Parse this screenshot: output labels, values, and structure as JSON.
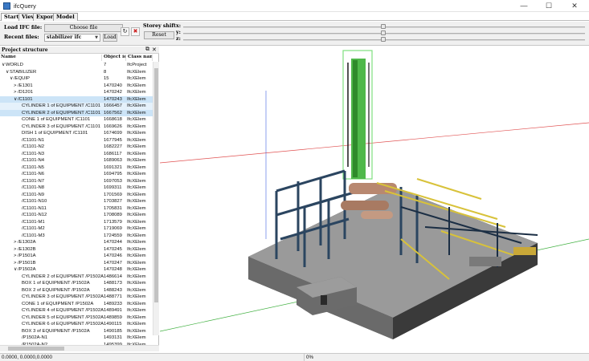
{
  "window": {
    "title": "ifcQuery",
    "min_icon": "minimize-icon",
    "max_icon": "maximize-icon",
    "close_icon": "close-icon"
  },
  "menu": {
    "tabs": [
      "Start",
      "View",
      "Export",
      "Model"
    ],
    "active": "Start"
  },
  "ribbon": {
    "load_ifc_label": "Load IFC file:",
    "choose_file": "Choose file",
    "recent_label": "Recent files:",
    "recent_value": "stabilizer ifc",
    "load_button": "Load",
    "storey_label": "Storey shift",
    "axis_x": "x:",
    "axis_y": "y:",
    "axis_z": "z:",
    "reset": "Reset",
    "icons": [
      "refresh-icon",
      "delete-icon"
    ]
  },
  "panel": {
    "title": "Project structure",
    "columns": [
      "Name",
      "Object id",
      "Class name"
    ],
    "rows": [
      {
        "name": "WORLD",
        "id": "7",
        "cls": "IfcProject",
        "indent": 0,
        "exp": "∨"
      },
      {
        "name": "STABILIZER",
        "id": "8",
        "cls": "IfcXElem",
        "indent": 1,
        "exp": "∨"
      },
      {
        "name": "/EQUIP",
        "id": "15",
        "cls": "IfcXElem",
        "indent": 2,
        "exp": "∨"
      },
      {
        "name": "/E1301",
        "id": "1470240",
        "cls": "IfcXElem",
        "indent": 3,
        "exp": ">"
      },
      {
        "name": "/D1201",
        "id": "1470242",
        "cls": "IfcXElem",
        "indent": 3,
        "exp": ">"
      },
      {
        "name": "/C1101",
        "id": "1470243",
        "cls": "IfcXElem",
        "indent": 3,
        "exp": "∨",
        "state": "sel"
      },
      {
        "name": "CYLINDER 1 of EQUIPMENT /C1101",
        "id": "1666457",
        "cls": "IfcXElem",
        "indent": 4,
        "exp": "",
        "state": "hl"
      },
      {
        "name": "CYLINDER 2 of EQUIPMENT /C1101",
        "id": "1667562",
        "cls": "IfcXElem",
        "indent": 4,
        "exp": "",
        "state": "sel"
      },
      {
        "name": "CONE 1 of EQUIPMENT /C1101",
        "id": "1668618",
        "cls": "IfcXElem",
        "indent": 4,
        "exp": ""
      },
      {
        "name": "CYLINDER 3 of EQUIPMENT /C1101",
        "id": "1669626",
        "cls": "IfcXElem",
        "indent": 4,
        "exp": ""
      },
      {
        "name": "DISH 1 of EQUIPMENT /C1101",
        "id": "1674699",
        "cls": "IfcXElem",
        "indent": 4,
        "exp": ""
      },
      {
        "name": "/C1101-N1",
        "id": "1677945",
        "cls": "IfcXElem",
        "indent": 4,
        "exp": ""
      },
      {
        "name": "/C1101-N2",
        "id": "1682227",
        "cls": "IfcXElem",
        "indent": 4,
        "exp": ""
      },
      {
        "name": "/C1101-N3",
        "id": "1686117",
        "cls": "IfcXElem",
        "indent": 4,
        "exp": ""
      },
      {
        "name": "/C1101-N4",
        "id": "1689063",
        "cls": "IfcXElem",
        "indent": 4,
        "exp": ""
      },
      {
        "name": "/C1101-N5",
        "id": "1691321",
        "cls": "IfcXElem",
        "indent": 4,
        "exp": ""
      },
      {
        "name": "/C1101-N6",
        "id": "1694795",
        "cls": "IfcXElem",
        "indent": 4,
        "exp": ""
      },
      {
        "name": "/C1101-N7",
        "id": "1697053",
        "cls": "IfcXElem",
        "indent": 4,
        "exp": ""
      },
      {
        "name": "/C1101-N8",
        "id": "1699311",
        "cls": "IfcXElem",
        "indent": 4,
        "exp": ""
      },
      {
        "name": "/C1101-N9",
        "id": "1701569",
        "cls": "IfcXElem",
        "indent": 4,
        "exp": ""
      },
      {
        "name": "/C1101-N10",
        "id": "1703827",
        "cls": "IfcXElem",
        "indent": 4,
        "exp": ""
      },
      {
        "name": "/C1101-N11",
        "id": "1705831",
        "cls": "IfcXElem",
        "indent": 4,
        "exp": ""
      },
      {
        "name": "/C1101-N12",
        "id": "1708089",
        "cls": "IfcXElem",
        "indent": 4,
        "exp": ""
      },
      {
        "name": "/C1101-M1",
        "id": "1713579",
        "cls": "IfcXElem",
        "indent": 4,
        "exp": ""
      },
      {
        "name": "/C1101-M2",
        "id": "1719069",
        "cls": "IfcXElem",
        "indent": 4,
        "exp": ""
      },
      {
        "name": "/C1101-M3",
        "id": "1724559",
        "cls": "IfcXElem",
        "indent": 4,
        "exp": ""
      },
      {
        "name": "/E1302A",
        "id": "1470244",
        "cls": "IfcXElem",
        "indent": 3,
        "exp": ">"
      },
      {
        "name": "/E1302B",
        "id": "1470245",
        "cls": "IfcXElem",
        "indent": 3,
        "exp": ">"
      },
      {
        "name": "/P1501A",
        "id": "1470246",
        "cls": "IfcXElem",
        "indent": 3,
        "exp": ">"
      },
      {
        "name": "/P1501B",
        "id": "1470247",
        "cls": "IfcXElem",
        "indent": 3,
        "exp": ">"
      },
      {
        "name": "/P1502A",
        "id": "1470248",
        "cls": "IfcXElem",
        "indent": 3,
        "exp": "∨"
      },
      {
        "name": "CYLINDER 2 of EQUIPMENT /P1502A",
        "id": "1486614",
        "cls": "IfcXElem",
        "indent": 4,
        "exp": ""
      },
      {
        "name": "BOX 1 of EQUIPMENT /P1502A",
        "id": "1488173",
        "cls": "IfcXElem",
        "indent": 4,
        "exp": ""
      },
      {
        "name": "BOX 2 of EQUIPMENT /P1502A",
        "id": "1488243",
        "cls": "IfcXElem",
        "indent": 4,
        "exp": ""
      },
      {
        "name": "CYLINDER 3 of EQUIPMENT /P1502A",
        "id": "1488771",
        "cls": "IfcXElem",
        "indent": 4,
        "exp": ""
      },
      {
        "name": "CONE 1 of EQUIPMENT /P1502A",
        "id": "1489233",
        "cls": "IfcXElem",
        "indent": 4,
        "exp": ""
      },
      {
        "name": "CYLINDER 4 of EQUIPMENT /P1502A",
        "id": "1489491",
        "cls": "IfcXElem",
        "indent": 4,
        "exp": ""
      },
      {
        "name": "CYLINDER 5 of EQUIPMENT /P1502A",
        "id": "1489859",
        "cls": "IfcXElem",
        "indent": 4,
        "exp": ""
      },
      {
        "name": "CYLINDER 6 of EQUIPMENT /P1502A",
        "id": "1490115",
        "cls": "IfcXElem",
        "indent": 4,
        "exp": ""
      },
      {
        "name": "BOX 3 of EQUIPMENT /P1502A",
        "id": "1490185",
        "cls": "IfcXElem",
        "indent": 4,
        "exp": ""
      },
      {
        "name": "/P1502A-N1",
        "id": "1493131",
        "cls": "IfcXElem",
        "indent": 4,
        "exp": ""
      },
      {
        "name": "/P1502A-N2",
        "id": "1495399",
        "cls": "IfcXElem",
        "indent": 4,
        "exp": ""
      }
    ]
  },
  "status": {
    "coords": "0.0000, 0.0000,0.0000",
    "progress": "0%"
  },
  "colors": {
    "accent": "#0078d7",
    "selection": "#cce4f7",
    "steel": "#2b4560",
    "column": "#4fb84a",
    "yellow": "#d8c23a",
    "vessel": "#b88870",
    "deck": "#5c5c5c"
  }
}
